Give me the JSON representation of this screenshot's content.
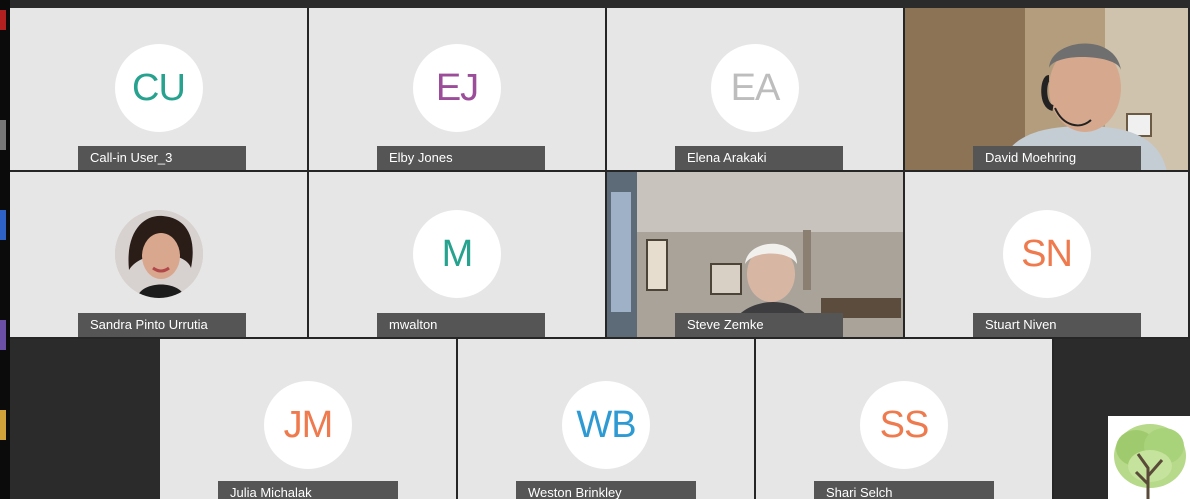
{
  "colors": {
    "teal": "#27a28f",
    "purple": "#9b4d9a",
    "gray": "#bdbdbd",
    "orange": "#ef7a4d",
    "blue": "#2e9ad3",
    "namebar": "#555555",
    "tile": "#e6e6e6"
  },
  "participants": [
    {
      "initials": "CU",
      "name": "Call-in User_3",
      "color": "teal",
      "video": false
    },
    {
      "initials": "EJ",
      "name": "Elby Jones",
      "color": "purple",
      "video": false
    },
    {
      "initials": "EA",
      "name": "Elena Arakaki",
      "color": "gray",
      "video": false
    },
    {
      "initials": "",
      "name": "David Moehring",
      "video": true
    },
    {
      "initials": "",
      "name": "Sandra Pinto Urrutia",
      "photo": true
    },
    {
      "initials": "M",
      "name": "mwalton",
      "color": "teal",
      "video": false
    },
    {
      "initials": "",
      "name": "Steve Zemke",
      "video": true
    },
    {
      "initials": "SN",
      "name": "Stuart Niven",
      "color": "orange",
      "video": false
    },
    {
      "initials": "JM",
      "name": "Julia Michalak",
      "color": "orange",
      "video": false
    },
    {
      "initials": "WB",
      "name": "Weston Brinkley",
      "color": "blue",
      "video": false
    },
    {
      "initials": "SS",
      "name": "Shari Selch",
      "color": "orange",
      "video": false
    }
  ],
  "logo": "tree-logo"
}
